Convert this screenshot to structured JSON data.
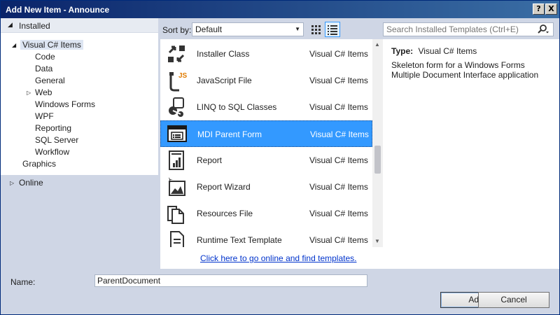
{
  "window": {
    "title": "Add New Item - Announce",
    "help_glyph": "?",
    "close_glyph": "X"
  },
  "tree": {
    "installed_label": "Installed",
    "items": [
      {
        "label": "Visual C# Items"
      },
      {
        "label": "Code"
      },
      {
        "label": "Data"
      },
      {
        "label": "General"
      },
      {
        "label": "Web"
      },
      {
        "label": "Windows Forms"
      },
      {
        "label": "WPF"
      },
      {
        "label": "Reporting"
      },
      {
        "label": "SQL Server"
      },
      {
        "label": "Workflow"
      },
      {
        "label": "Graphics"
      }
    ],
    "online_label": "Online"
  },
  "sort": {
    "label": "Sort by:",
    "value": "Default"
  },
  "search": {
    "placeholder": "Search Installed Templates (Ctrl+E)"
  },
  "templates": [
    {
      "name": "Installer Class",
      "lang": "Visual C# Items",
      "icon": "installer-icon"
    },
    {
      "name": "JavaScript File",
      "lang": "Visual C# Items",
      "icon": "javascript-file-icon",
      "badge": "JS"
    },
    {
      "name": "LINQ to SQL Classes",
      "lang": "Visual C# Items",
      "icon": "linq-icon"
    },
    {
      "name": "MDI Parent Form",
      "lang": "Visual C# Items",
      "icon": "mdi-form-icon",
      "selected": true
    },
    {
      "name": "Report",
      "lang": "Visual C# Items",
      "icon": "report-icon"
    },
    {
      "name": "Report Wizard",
      "lang": "Visual C# Items",
      "icon": "report-wizard-icon"
    },
    {
      "name": "Resources File",
      "lang": "Visual C# Items",
      "icon": "resources-file-icon"
    },
    {
      "name": "Runtime Text Template",
      "lang": "Visual C# Items",
      "icon": "text-template-icon"
    }
  ],
  "online_link": "Click here to go online and find templates.",
  "detail": {
    "type_label": "Type:",
    "type_value": "Visual C# Items",
    "description": "Skeleton form for a Windows Forms Multiple Document Interface application"
  },
  "name_field": {
    "label": "Name:",
    "value": "ParentDocument"
  },
  "buttons": {
    "add": "Add",
    "cancel": "Cancel"
  },
  "colors": {
    "selection": "#3399ff",
    "panel": "#cfd6e5",
    "title_start": "#0a246a",
    "link": "#0033cc"
  }
}
